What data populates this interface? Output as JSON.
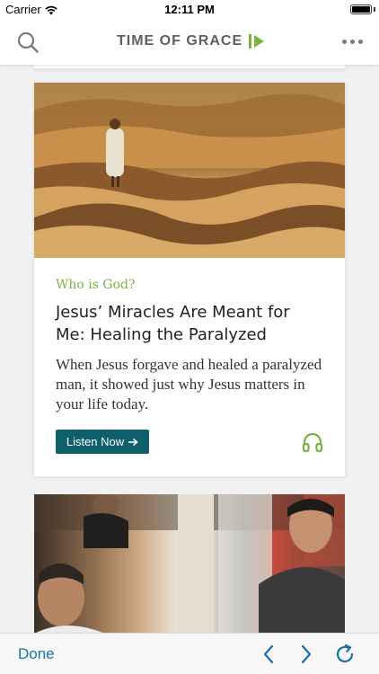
{
  "status_bar": {
    "carrier": "Carrier",
    "time": "12:11 PM",
    "icons": [
      "wifi-icon",
      "battery-icon"
    ]
  },
  "header": {
    "logo_text": "TIME OF GRACE",
    "icons": [
      "search-icon",
      "logo-play-icon",
      "more-icon"
    ]
  },
  "colors": {
    "accent_green": "#7cb342",
    "button_teal": "#0e5f6b",
    "link_blue": "#1a73a6",
    "logo_gray": "#5f5f5f"
  },
  "feed": {
    "cards": [
      {
        "category": "Who is God?",
        "headline": "Jesus’ Miracles Are Meant for Me: Healing the Paralyzed",
        "excerpt": "When Jesus forgave and healed a paralyzed man, it showed just why Jesus matters in your life today.",
        "listen_label": "Listen Now",
        "icons": [
          "arrow-right-icon",
          "headphones-icon"
        ]
      }
    ]
  },
  "toolbar": {
    "done_label": "Done",
    "icons": [
      "back-icon",
      "forward-icon",
      "refresh-icon"
    ]
  }
}
